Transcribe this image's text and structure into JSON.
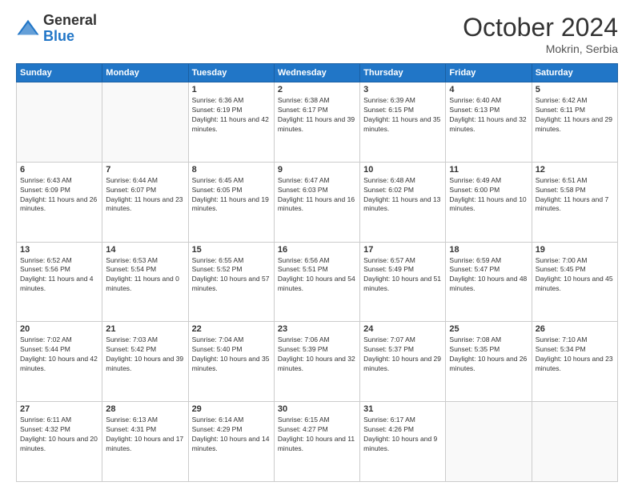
{
  "header": {
    "logo_general": "General",
    "logo_blue": "Blue",
    "month_year": "October 2024",
    "location": "Mokrin, Serbia"
  },
  "weekdays": [
    "Sunday",
    "Monday",
    "Tuesday",
    "Wednesday",
    "Thursday",
    "Friday",
    "Saturday"
  ],
  "weeks": [
    [
      {
        "day": "",
        "info": ""
      },
      {
        "day": "",
        "info": ""
      },
      {
        "day": "1",
        "info": "Sunrise: 6:36 AM\nSunset: 6:19 PM\nDaylight: 11 hours and 42 minutes."
      },
      {
        "day": "2",
        "info": "Sunrise: 6:38 AM\nSunset: 6:17 PM\nDaylight: 11 hours and 39 minutes."
      },
      {
        "day": "3",
        "info": "Sunrise: 6:39 AM\nSunset: 6:15 PM\nDaylight: 11 hours and 35 minutes."
      },
      {
        "day": "4",
        "info": "Sunrise: 6:40 AM\nSunset: 6:13 PM\nDaylight: 11 hours and 32 minutes."
      },
      {
        "day": "5",
        "info": "Sunrise: 6:42 AM\nSunset: 6:11 PM\nDaylight: 11 hours and 29 minutes."
      }
    ],
    [
      {
        "day": "6",
        "info": "Sunrise: 6:43 AM\nSunset: 6:09 PM\nDaylight: 11 hours and 26 minutes."
      },
      {
        "day": "7",
        "info": "Sunrise: 6:44 AM\nSunset: 6:07 PM\nDaylight: 11 hours and 23 minutes."
      },
      {
        "day": "8",
        "info": "Sunrise: 6:45 AM\nSunset: 6:05 PM\nDaylight: 11 hours and 19 minutes."
      },
      {
        "day": "9",
        "info": "Sunrise: 6:47 AM\nSunset: 6:03 PM\nDaylight: 11 hours and 16 minutes."
      },
      {
        "day": "10",
        "info": "Sunrise: 6:48 AM\nSunset: 6:02 PM\nDaylight: 11 hours and 13 minutes."
      },
      {
        "day": "11",
        "info": "Sunrise: 6:49 AM\nSunset: 6:00 PM\nDaylight: 11 hours and 10 minutes."
      },
      {
        "day": "12",
        "info": "Sunrise: 6:51 AM\nSunset: 5:58 PM\nDaylight: 11 hours and 7 minutes."
      }
    ],
    [
      {
        "day": "13",
        "info": "Sunrise: 6:52 AM\nSunset: 5:56 PM\nDaylight: 11 hours and 4 minutes."
      },
      {
        "day": "14",
        "info": "Sunrise: 6:53 AM\nSunset: 5:54 PM\nDaylight: 11 hours and 0 minutes."
      },
      {
        "day": "15",
        "info": "Sunrise: 6:55 AM\nSunset: 5:52 PM\nDaylight: 10 hours and 57 minutes."
      },
      {
        "day": "16",
        "info": "Sunrise: 6:56 AM\nSunset: 5:51 PM\nDaylight: 10 hours and 54 minutes."
      },
      {
        "day": "17",
        "info": "Sunrise: 6:57 AM\nSunset: 5:49 PM\nDaylight: 10 hours and 51 minutes."
      },
      {
        "day": "18",
        "info": "Sunrise: 6:59 AM\nSunset: 5:47 PM\nDaylight: 10 hours and 48 minutes."
      },
      {
        "day": "19",
        "info": "Sunrise: 7:00 AM\nSunset: 5:45 PM\nDaylight: 10 hours and 45 minutes."
      }
    ],
    [
      {
        "day": "20",
        "info": "Sunrise: 7:02 AM\nSunset: 5:44 PM\nDaylight: 10 hours and 42 minutes."
      },
      {
        "day": "21",
        "info": "Sunrise: 7:03 AM\nSunset: 5:42 PM\nDaylight: 10 hours and 39 minutes."
      },
      {
        "day": "22",
        "info": "Sunrise: 7:04 AM\nSunset: 5:40 PM\nDaylight: 10 hours and 35 minutes."
      },
      {
        "day": "23",
        "info": "Sunrise: 7:06 AM\nSunset: 5:39 PM\nDaylight: 10 hours and 32 minutes."
      },
      {
        "day": "24",
        "info": "Sunrise: 7:07 AM\nSunset: 5:37 PM\nDaylight: 10 hours and 29 minutes."
      },
      {
        "day": "25",
        "info": "Sunrise: 7:08 AM\nSunset: 5:35 PM\nDaylight: 10 hours and 26 minutes."
      },
      {
        "day": "26",
        "info": "Sunrise: 7:10 AM\nSunset: 5:34 PM\nDaylight: 10 hours and 23 minutes."
      }
    ],
    [
      {
        "day": "27",
        "info": "Sunrise: 6:11 AM\nSunset: 4:32 PM\nDaylight: 10 hours and 20 minutes."
      },
      {
        "day": "28",
        "info": "Sunrise: 6:13 AM\nSunset: 4:31 PM\nDaylight: 10 hours and 17 minutes."
      },
      {
        "day": "29",
        "info": "Sunrise: 6:14 AM\nSunset: 4:29 PM\nDaylight: 10 hours and 14 minutes."
      },
      {
        "day": "30",
        "info": "Sunrise: 6:15 AM\nSunset: 4:27 PM\nDaylight: 10 hours and 11 minutes."
      },
      {
        "day": "31",
        "info": "Sunrise: 6:17 AM\nSunset: 4:26 PM\nDaylight: 10 hours and 9 minutes."
      },
      {
        "day": "",
        "info": ""
      },
      {
        "day": "",
        "info": ""
      }
    ]
  ]
}
